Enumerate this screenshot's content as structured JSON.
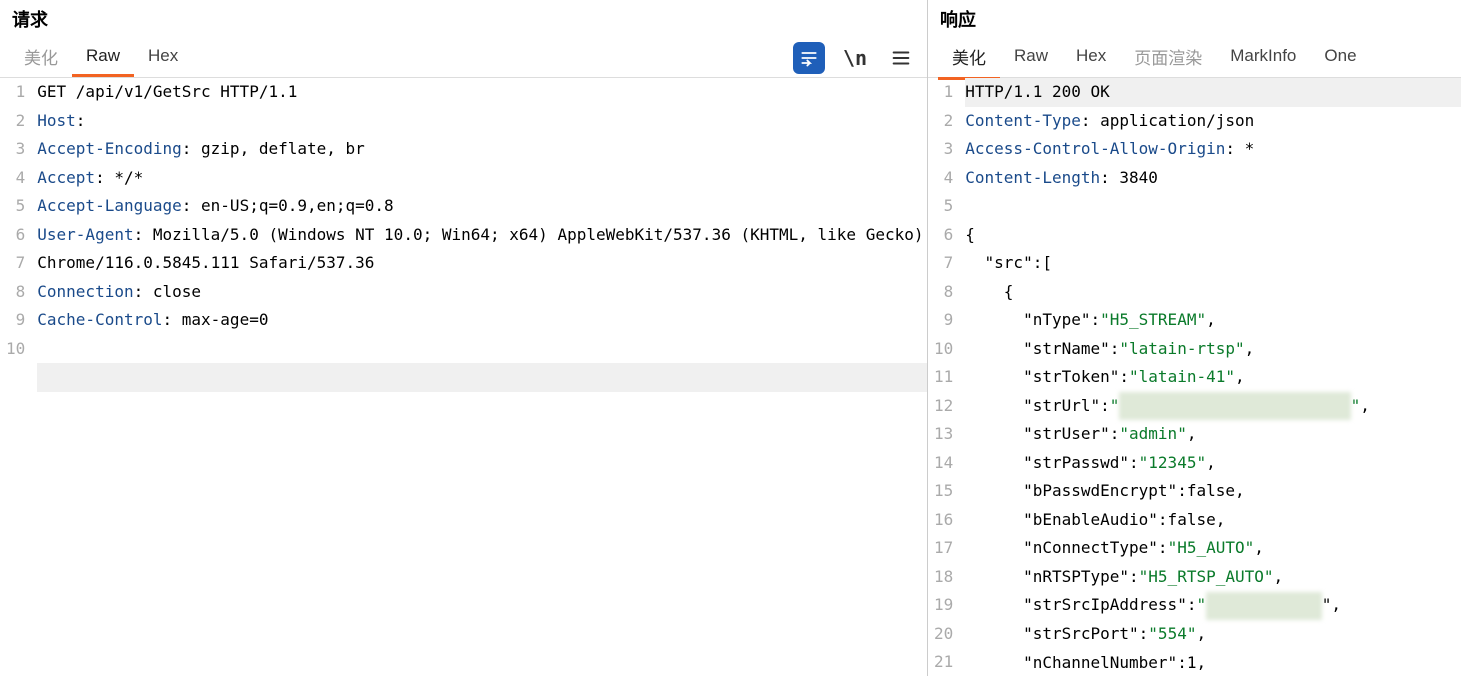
{
  "request": {
    "title": "请求",
    "tabs": {
      "pretty": "美化",
      "raw": "Raw",
      "hex": "Hex"
    },
    "active_tab": "raw",
    "lines": [
      {
        "n": 1,
        "parts": [
          {
            "t": "",
            "c": ""
          },
          {
            "t": "GET /api/v1/GetSrc HTTP/1.1",
            "c": ""
          }
        ]
      },
      {
        "n": 2,
        "parts": [
          {
            "t": "Host",
            "c": "hdr"
          },
          {
            "t": ": ",
            "c": ""
          }
        ]
      },
      {
        "n": 3,
        "parts": [
          {
            "t": "Accept-Encoding",
            "c": "hdr"
          },
          {
            "t": ": gzip, deflate, br",
            "c": ""
          }
        ]
      },
      {
        "n": 4,
        "parts": [
          {
            "t": "Accept",
            "c": "hdr"
          },
          {
            "t": ": */*",
            "c": ""
          }
        ]
      },
      {
        "n": 5,
        "parts": [
          {
            "t": "Accept-Language",
            "c": "hdr"
          },
          {
            "t": ": en-US;q=0.9,en;q=0.8",
            "c": ""
          }
        ]
      },
      {
        "n": 6,
        "parts": [
          {
            "t": "User-Agent",
            "c": "hdr"
          },
          {
            "t": ": Mozilla/5.0 (Windows NT 10.0; Win64; x64) AppleWebKit/537.36 (KHTML, like Gecko) Chrome/116.0.5845.111 Safari/537.36",
            "c": ""
          }
        ]
      },
      {
        "n": 7,
        "parts": [
          {
            "t": "Connection",
            "c": "hdr"
          },
          {
            "t": ": close",
            "c": ""
          }
        ]
      },
      {
        "n": 8,
        "parts": [
          {
            "t": "Cache-Control",
            "c": "hdr"
          },
          {
            "t": ": max-age=0",
            "c": ""
          }
        ]
      },
      {
        "n": 9,
        "parts": []
      },
      {
        "n": 10,
        "parts": [],
        "hl": true
      }
    ]
  },
  "response": {
    "title": "响应",
    "tabs": {
      "pretty": "美化",
      "raw": "Raw",
      "hex": "Hex",
      "render": "页面渲染",
      "markinfo": "MarkInfo",
      "one": "One"
    },
    "active_tab": "pretty",
    "lines": [
      {
        "n": 1,
        "hl": true,
        "parts": [
          {
            "t": "HTTP/1.1 200 OK",
            "c": ""
          }
        ]
      },
      {
        "n": 2,
        "parts": [
          {
            "t": "Content-Type",
            "c": "hdr"
          },
          {
            "t": ": application/json",
            "c": ""
          }
        ]
      },
      {
        "n": 3,
        "parts": [
          {
            "t": "Access-Control-Allow-Origin",
            "c": "hdr"
          },
          {
            "t": ": *",
            "c": ""
          }
        ]
      },
      {
        "n": 4,
        "parts": [
          {
            "t": "Content-Length",
            "c": "hdr"
          },
          {
            "t": ": 3840",
            "c": ""
          }
        ]
      },
      {
        "n": 5,
        "parts": []
      },
      {
        "n": 6,
        "parts": [
          {
            "t": "{",
            "c": ""
          }
        ]
      },
      {
        "n": 7,
        "parts": [
          {
            "t": "  \"src\":[",
            "c": ""
          }
        ]
      },
      {
        "n": 8,
        "parts": [
          {
            "t": "    {",
            "c": ""
          }
        ]
      },
      {
        "n": 9,
        "parts": [
          {
            "t": "      \"nType\":",
            "c": ""
          },
          {
            "t": "\"H5_STREAM\"",
            "c": "str"
          },
          {
            "t": ",",
            "c": ""
          }
        ]
      },
      {
        "n": 10,
        "parts": [
          {
            "t": "      \"strName\":",
            "c": ""
          },
          {
            "t": "\"latain-rtsp\"",
            "c": "str"
          },
          {
            "t": ",",
            "c": ""
          }
        ]
      },
      {
        "n": 11,
        "parts": [
          {
            "t": "      \"strToken\":",
            "c": ""
          },
          {
            "t": "\"latain-41\"",
            "c": "str"
          },
          {
            "t": ",",
            "c": ""
          }
        ]
      },
      {
        "n": 12,
        "parts": [
          {
            "t": "      \"strUrl\":",
            "c": ""
          },
          {
            "t": "\"",
            "c": "str"
          },
          {
            "t": "████████████████████████",
            "c": "redacted"
          },
          {
            "t": "\"",
            "c": "str"
          },
          {
            "t": ",",
            "c": ""
          }
        ]
      },
      {
        "n": 13,
        "parts": [
          {
            "t": "      \"strUser\":",
            "c": ""
          },
          {
            "t": "\"admin\"",
            "c": "str"
          },
          {
            "t": ",",
            "c": ""
          }
        ]
      },
      {
        "n": 14,
        "parts": [
          {
            "t": "      \"strPasswd\":",
            "c": ""
          },
          {
            "t": "\"12345\"",
            "c": "str"
          },
          {
            "t": ",",
            "c": ""
          }
        ]
      },
      {
        "n": 15,
        "parts": [
          {
            "t": "      \"bPasswdEncrypt\":false,",
            "c": ""
          }
        ]
      },
      {
        "n": 16,
        "parts": [
          {
            "t": "      \"bEnableAudio\":false,",
            "c": ""
          }
        ]
      },
      {
        "n": 17,
        "parts": [
          {
            "t": "      \"nConnectType\":",
            "c": ""
          },
          {
            "t": "\"H5_AUTO\"",
            "c": "str"
          },
          {
            "t": ",",
            "c": ""
          }
        ]
      },
      {
        "n": 18,
        "parts": [
          {
            "t": "      \"nRTSPType\":",
            "c": ""
          },
          {
            "t": "\"H5_RTSP_AUTO\"",
            "c": "str"
          },
          {
            "t": ",",
            "c": ""
          }
        ]
      },
      {
        "n": 19,
        "parts": [
          {
            "t": "      \"strSrcIpAddress\":",
            "c": ""
          },
          {
            "t": "\"",
            "c": "str"
          },
          {
            "t": "████████████",
            "c": "redacted"
          },
          {
            "t": "\",",
            "c": ""
          }
        ]
      },
      {
        "n": 20,
        "parts": [
          {
            "t": "      \"strSrcPort\":",
            "c": ""
          },
          {
            "t": "\"554\"",
            "c": "str"
          },
          {
            "t": ",",
            "c": ""
          }
        ]
      },
      {
        "n": 21,
        "parts": [
          {
            "t": "      \"nChannelNumber\":1,",
            "c": ""
          }
        ]
      }
    ]
  }
}
